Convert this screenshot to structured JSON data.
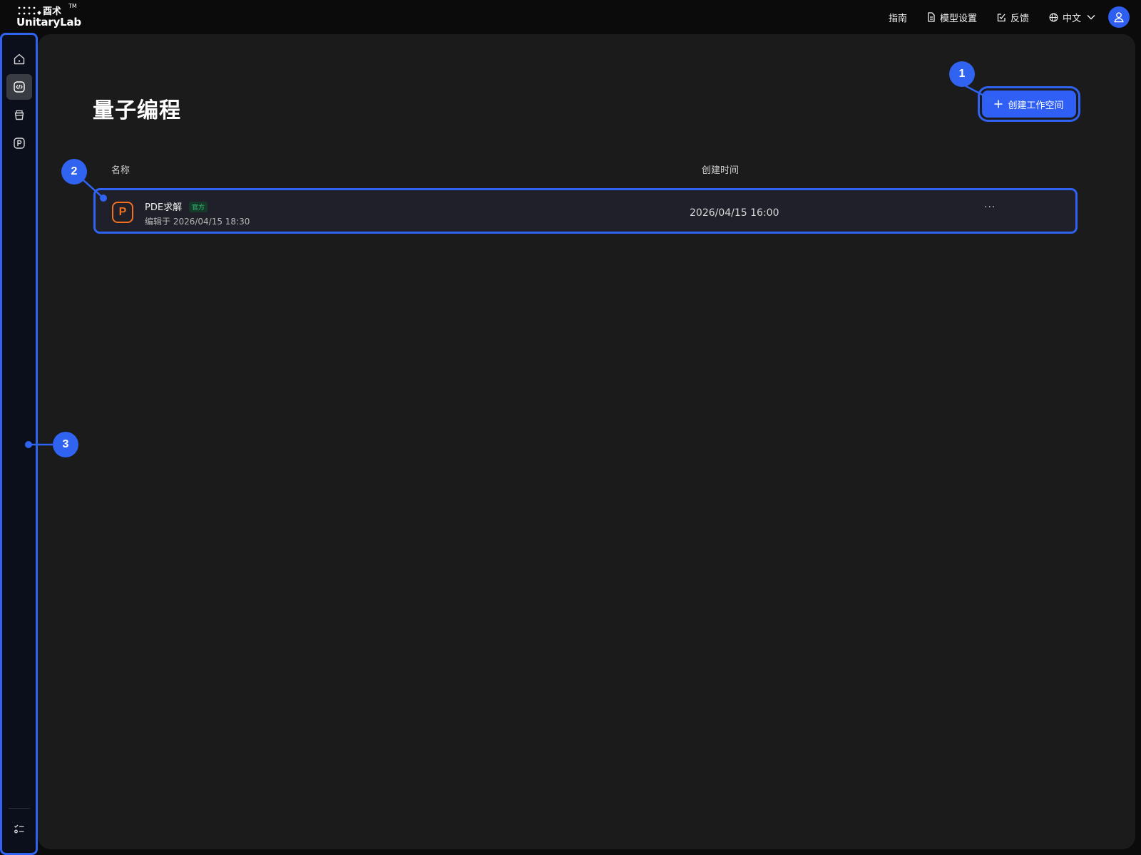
{
  "brand": {
    "cn_name": "酉术",
    "name": "UnitaryLab",
    "tm": "TM"
  },
  "header": {
    "guide_label": "指南",
    "model_settings_label": "模型设置",
    "feedback_label": "反馈",
    "language_label": "中文"
  },
  "sidebar": {
    "items": [
      {
        "name": "home",
        "icon": "home-icon",
        "active": false
      },
      {
        "name": "quantum-programming",
        "icon": "code-icon",
        "active": true
      },
      {
        "name": "bucket",
        "icon": "bucket-icon",
        "active": false
      },
      {
        "name": "pde",
        "icon": "p-square-icon",
        "active": false
      }
    ],
    "bottom_icon": "checklist-icon"
  },
  "main": {
    "title": "量子编程",
    "create_button_label": "创建工作空间",
    "columns": {
      "name": "名称",
      "created_time": "创建时间"
    },
    "rows": [
      {
        "icon_letter": "P",
        "name": "PDE求解",
        "badge": "官方",
        "edited": "编辑于 2026/04/15 18:30",
        "created": "2026/04/15 16:00",
        "more": "···"
      }
    ]
  },
  "callouts": [
    "1",
    "2",
    "3"
  ],
  "colors": {
    "accent": "#2f63f0",
    "pde_icon": "#f07020",
    "badge_text": "#39c07a",
    "background": "#1b1b1c"
  }
}
